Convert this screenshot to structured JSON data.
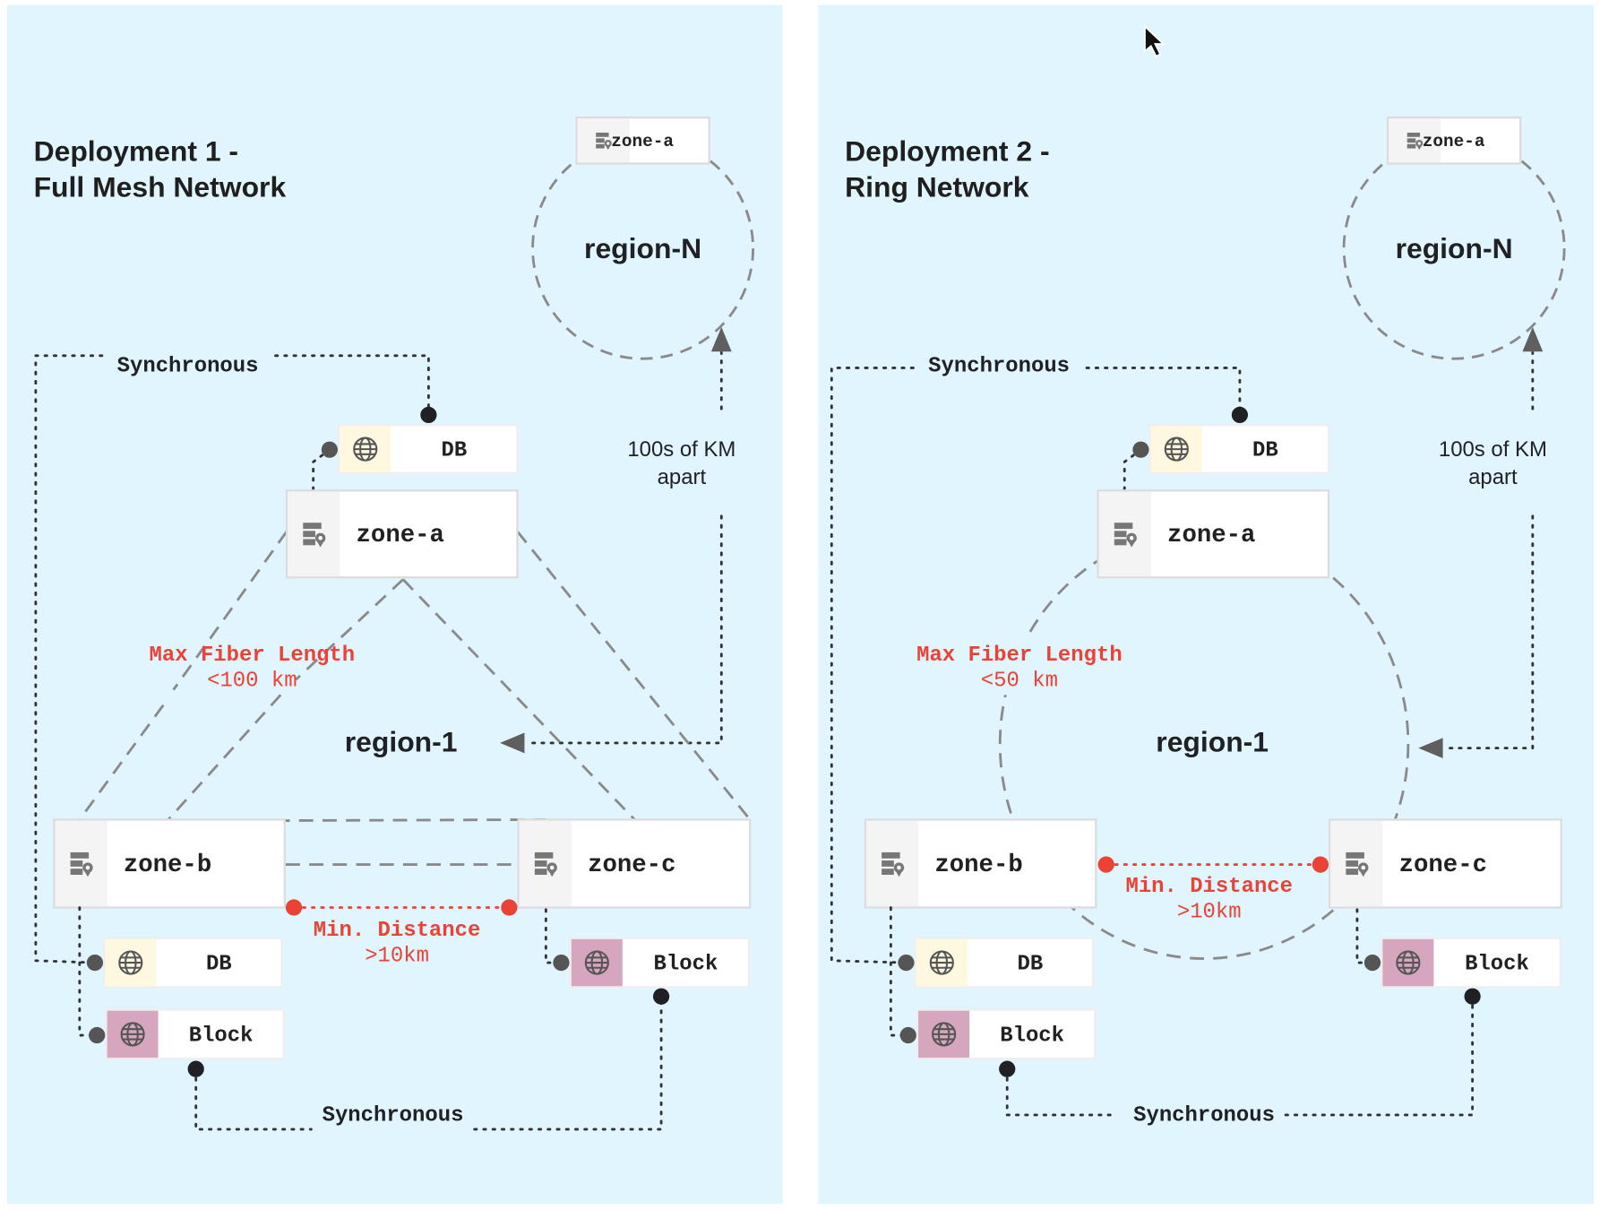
{
  "colors": {
    "panel_background": "#e1f5fe",
    "fiber_label": "#ea4335",
    "db_icon_background": "#fff8e1",
    "block_icon_background": "#d5a6bd",
    "zone_icon_background": "#f4f4f4",
    "dashed_line": "#8a8a8a"
  },
  "icons": {
    "zone": "server-location-icon",
    "service": "globe-icon",
    "cursor": "mouse-pointer-icon"
  },
  "panels": [
    {
      "title_line1": "Deployment 1 -",
      "title_line2": "Full Mesh Network",
      "topology": "full-mesh",
      "remote_region": "region-N",
      "remote_zone": "zone-a",
      "distance_line1": "100s of KM",
      "distance_line2": "apart",
      "sync_top": "Synchronous",
      "sync_bottom": "Synchronous",
      "db_top": "DB",
      "zone_a": "zone-a",
      "zone_b": "zone-b",
      "zone_c": "zone-c",
      "max_fiber_label": "Max Fiber Length",
      "max_fiber_value": "<100 km",
      "region": "region-1",
      "min_distance_label": "Min. Distance",
      "min_distance_value": ">10km",
      "db_b": "DB",
      "block_b": "Block",
      "block_c": "Block"
    },
    {
      "title_line1": "Deployment 2 -",
      "title_line2": "Ring Network",
      "topology": "ring",
      "remote_region": "region-N",
      "remote_zone": "zone-a",
      "distance_line1": "100s of KM",
      "distance_line2": "apart",
      "sync_top": "Synchronous",
      "sync_bottom": "Synchronous",
      "db_top": "DB",
      "zone_a": "zone-a",
      "zone_b": "zone-b",
      "zone_c": "zone-c",
      "max_fiber_label": "Max Fiber Length",
      "max_fiber_value": "<50 km",
      "region": "region-1",
      "min_distance_label": "Min. Distance",
      "min_distance_value": ">10km",
      "db_b": "DB",
      "block_b": "Block",
      "block_c": "Block"
    }
  ]
}
